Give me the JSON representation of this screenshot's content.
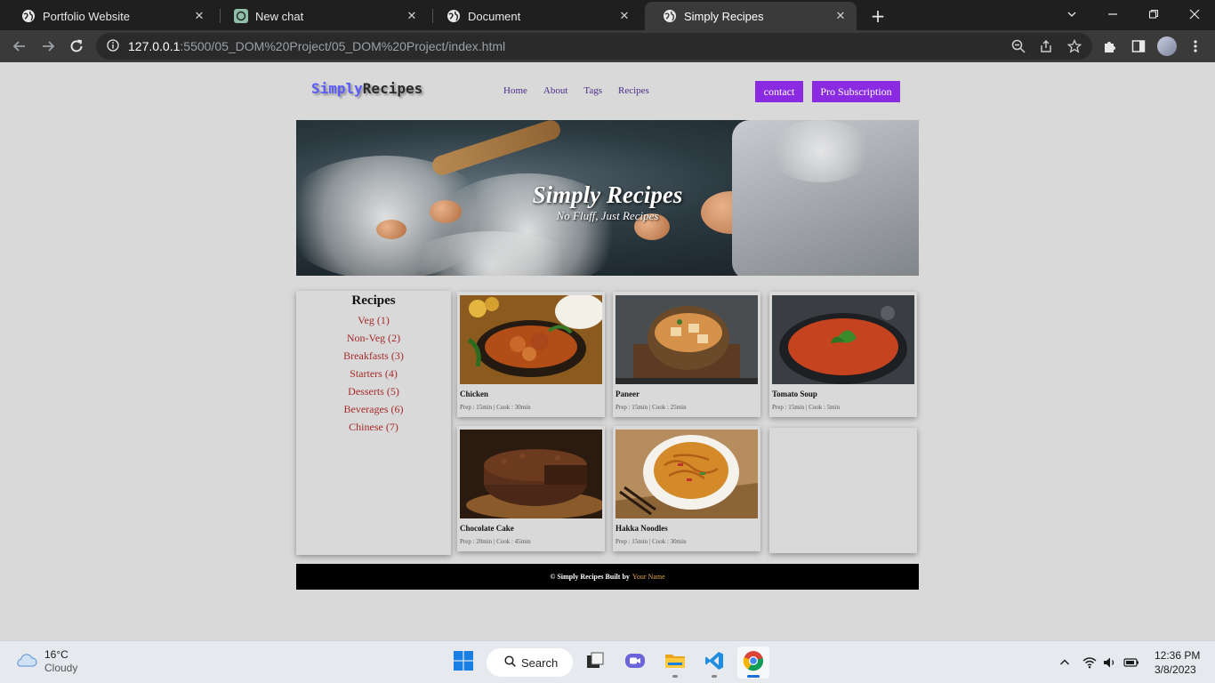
{
  "browser": {
    "tabs": [
      {
        "title": "Portfolio Website",
        "icon": "globe-icon"
      },
      {
        "title": "New chat",
        "icon": "openai-icon"
      },
      {
        "title": "Document",
        "icon": "globe-icon"
      },
      {
        "title": "Simply Recipes",
        "icon": "globe-icon",
        "active": true
      }
    ],
    "url_host": "127.0.0.1",
    "url_path": ":5500/05_DOM%20Project/05_DOM%20Project/index.html"
  },
  "site": {
    "logo_part1": "Simply",
    "logo_part2": "Recipes",
    "nav": [
      "Home",
      "About",
      "Tags",
      "Recipes"
    ],
    "contact_label": "contact",
    "subscription_label": "Pro Subscription",
    "hero_title": "Simply Recipes",
    "hero_subtitle": "No Fluff, Just Recipes",
    "sidebar_title": "Recipes",
    "categories": [
      "Veg (1)",
      "Non-Veg (2)",
      "Breakfasts (3)",
      "Starters (4)",
      "Desserts (5)",
      "Beverages (6)",
      "Chinese (7)"
    ],
    "recipes": [
      {
        "name": "Chicken",
        "meta": "Prep : 15min | Cook : 30min"
      },
      {
        "name": "Paneer",
        "meta": "Prep : 15min | Cook : 25min"
      },
      {
        "name": "Tomato Soup",
        "meta": "Prep : 15min | Cook : 5min"
      },
      {
        "name": "Chocolate Cake",
        "meta": "Prep : 20min | Cook : 45min"
      },
      {
        "name": "Hakka Noodles",
        "meta": "Prep : 15min | Cook : 30min"
      }
    ],
    "footer_text": "© Simply Recipes Built by",
    "footer_author": "Your Name"
  },
  "taskbar": {
    "temperature": "16°C",
    "condition": "Cloudy",
    "search_label": "Search",
    "time": "12:36 PM",
    "date": "3/8/2023"
  },
  "colors": {
    "accent_purple": "#8a2be2",
    "category_link": "#a52a2a",
    "page_bg": "#d9d9d9"
  }
}
